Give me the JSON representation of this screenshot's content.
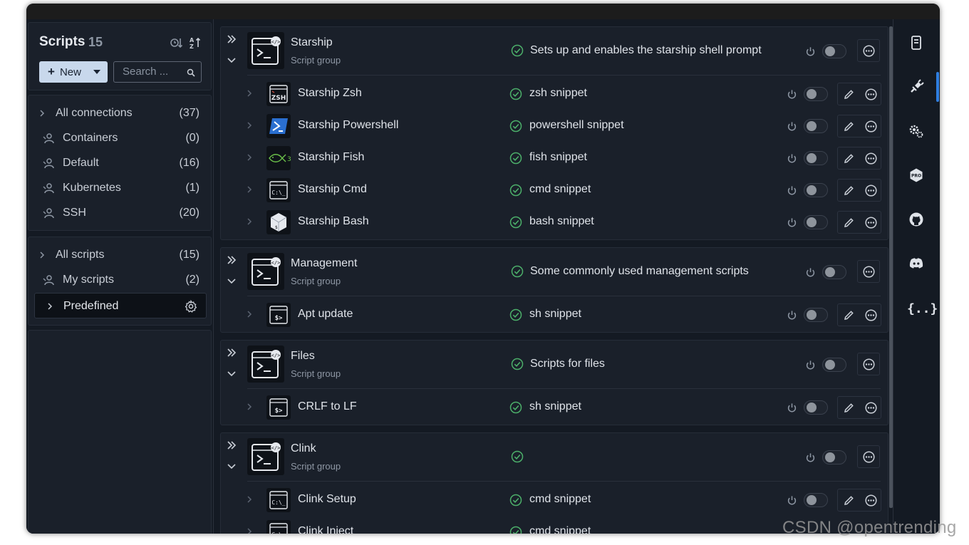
{
  "sidebar": {
    "title": "Scripts",
    "count": "15",
    "new_label": "New",
    "search_placeholder": "Search ...",
    "connections": [
      {
        "label": "All connections",
        "count": "(37)"
      },
      {
        "label": "Containers",
        "count": "(0)"
      },
      {
        "label": "Default",
        "count": "(16)"
      },
      {
        "label": "Kubernetes",
        "count": "(1)"
      },
      {
        "label": "SSH",
        "count": "(20)"
      }
    ],
    "scripts": [
      {
        "label": "All scripts",
        "count": "(15)"
      },
      {
        "label": "My scripts",
        "count": "(2)"
      },
      {
        "label": "Predefined",
        "count": ""
      }
    ]
  },
  "groups": [
    {
      "name": "Starship",
      "type": "Script group",
      "description": "Sets up and enables the starship shell prompt",
      "items": [
        {
          "name": "Starship Zsh",
          "lang": "zsh  snippet",
          "icon": "zsh-icon"
        },
        {
          "name": "Starship Powershell",
          "lang": "powershell  snippet",
          "icon": "powershell-icon"
        },
        {
          "name": "Starship Fish",
          "lang": "fish  snippet",
          "icon": "fish-icon"
        },
        {
          "name": "Starship Cmd",
          "lang": "cmd  snippet",
          "icon": "cmd-icon"
        },
        {
          "name": "Starship Bash",
          "lang": "bash  snippet",
          "icon": "bash-icon"
        }
      ]
    },
    {
      "name": "Management",
      "type": "Script group",
      "description": "Some commonly used management scripts",
      "items": [
        {
          "name": "Apt update",
          "lang": "sh  snippet",
          "icon": "sh-icon"
        }
      ]
    },
    {
      "name": "Files",
      "type": "Script group",
      "description": "Scripts for files",
      "items": [
        {
          "name": "CRLF to LF",
          "lang": "sh  snippet",
          "icon": "sh-icon"
        }
      ]
    },
    {
      "name": "Clink",
      "type": "Script group",
      "description": "",
      "items": [
        {
          "name": "Clink Setup",
          "lang": "cmd  snippet",
          "icon": "cmd-icon"
        },
        {
          "name": "Clink Inject",
          "lang": "cmd  snippet",
          "icon": "cmd-icon"
        }
      ]
    }
  ],
  "rail": {
    "icons": [
      "connections-icon",
      "scripts-icon",
      "settings-icon",
      "pro-icon",
      "github-icon",
      "discord-icon",
      "json-icon"
    ],
    "json_label": "{..}"
  },
  "watermark": "CSDN @opentrending",
  "colors": {
    "background": "#141a23",
    "panel": "#1a202a",
    "accent": "#2f7ee0",
    "check": "#4caf6a",
    "new_button": "#c8d8ec"
  }
}
